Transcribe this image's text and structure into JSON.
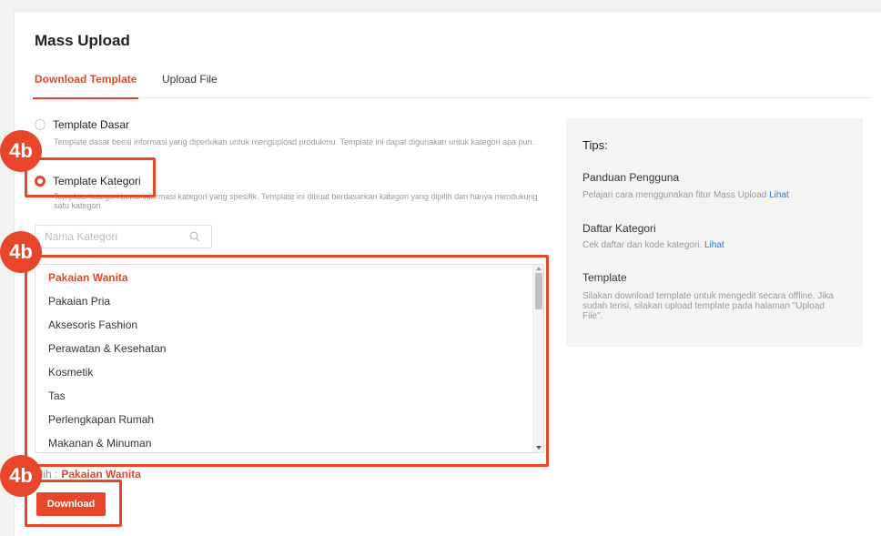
{
  "page": {
    "title": "Mass Upload"
  },
  "tabs": [
    {
      "label": "Download Template",
      "active": true
    },
    {
      "label": "Upload File",
      "active": false
    }
  ],
  "template_options": [
    {
      "label": "Template Dasar",
      "description": "Template dasar berisi informasi yang diperlukan untuk mengupload produkmu. Template ini dapat digunakan untuk kategori apa pun.",
      "checked": false
    },
    {
      "label": "Template Kategori",
      "description": "Template kategori berisi informasi kategori yang spesifik. Template ini dibuat berdasarkan kategori yang dipilih dan hanya mendukung satu kategori.",
      "checked": true
    }
  ],
  "search": {
    "placeholder": "Nama Kategori",
    "value": "",
    "icon": "search-icon"
  },
  "categories": [
    "Pakaian Wanita",
    "Pakaian Pria",
    "Aksesoris Fashion",
    "Perawatan & Kesehatan",
    "Kosmetik",
    "Tas",
    "Perlengkapan Rumah",
    "Makanan & Minuman"
  ],
  "selected_category": "Pakaian Wanita",
  "picked": {
    "label": "ilih :",
    "value": "Pakaian Wanita"
  },
  "download_label": "Download",
  "tips": {
    "title": "Tips:",
    "items": [
      {
        "heading": "Panduan Pengguna",
        "text": "Pelajari cara menggunakan fitur Mass Upload",
        "link": "Lihat"
      },
      {
        "heading": "Daftar Kategori",
        "text": "Cek daftar dan kode kategori.",
        "link": "Lihat"
      },
      {
        "heading": "Template",
        "text": "Silakan download template untuk mengedit secara offline. Jika sudah terisi, silakan upload template pada halaman \"Upload File\".",
        "link": ""
      }
    ]
  },
  "annotations": {
    "badge_text": "4b"
  },
  "colors": {
    "accent": "#e8462b",
    "link": "#2a7ad5",
    "tips_bg": "#f4f4f4"
  }
}
